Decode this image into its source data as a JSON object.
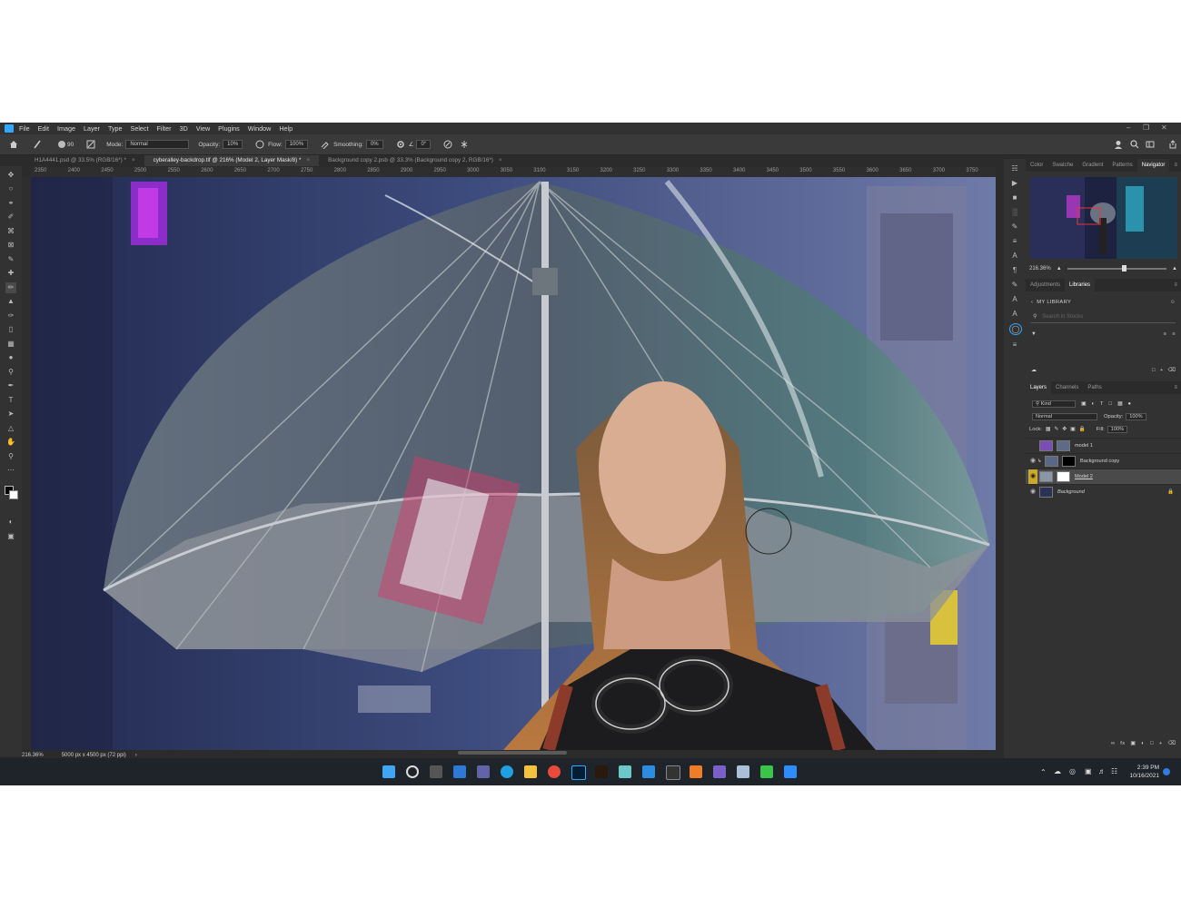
{
  "menubar": {
    "items": [
      "File",
      "Edit",
      "Image",
      "Layer",
      "Type",
      "Select",
      "Filter",
      "3D",
      "View",
      "Plugins",
      "Window",
      "Help"
    ]
  },
  "options": {
    "brush_size": "90",
    "mode_label": "Mode:",
    "mode_value": "Normal",
    "opacity_label": "Opacity:",
    "opacity_value": "10%",
    "flow_label": "Flow:",
    "flow_value": "100%",
    "smoothing_label": "Smoothing:",
    "smoothing_value": "0%",
    "angle_value": "0°"
  },
  "tabs": [
    {
      "label": "H1A4441.psd @ 33.5% (RGB/16*) *"
    },
    {
      "label": "cyberalley-backdrop.tif @ 216% (Model 2, Layer Mask/8) *"
    },
    {
      "label": "Background copy 2.psb @ 33.3% (Background copy 2, RGB/16*)"
    }
  ],
  "ruler": {
    "ticks": [
      "2350",
      "2400",
      "2450",
      "2500",
      "2550",
      "2600",
      "2650",
      "2700",
      "2750",
      "2800",
      "2850",
      "2900",
      "2950",
      "3000",
      "3050",
      "3100",
      "3150",
      "3200",
      "3250",
      "3300",
      "3350",
      "3400",
      "3450",
      "3500",
      "3550",
      "3600",
      "3650",
      "3700",
      "3750"
    ]
  },
  "status": {
    "zoom": "216.36%",
    "doc_size": "5000 px x 4500 px (72 ppi)"
  },
  "panels": {
    "top_tabs": [
      "Color",
      "Swatche",
      "Gradient",
      "Patterns",
      "Navigator"
    ],
    "navigator_zoom": "216.36%",
    "mid_tabs": [
      "Adjustments",
      "Libraries"
    ],
    "library_name": "MY LIBRARY",
    "library_search_placeholder": "Search in Stocks",
    "layer_tabs": [
      "Layers",
      "Channels",
      "Paths"
    ],
    "kind_label": "Kind",
    "blend_mode": "Normal",
    "opacity_label": "Opacity:",
    "opacity_value": "100%",
    "lock_label": "Lock:",
    "fill_label": "Fill:",
    "fill_value": "100%",
    "layers": [
      {
        "name": "model 1",
        "visible": false
      },
      {
        "name": "Background copy",
        "visible": true
      },
      {
        "name": "Model 2",
        "visible": true
      },
      {
        "name": "Background",
        "visible": true
      }
    ]
  },
  "taskbar": {
    "time": "2:39 PM",
    "date": "10/16/2021"
  },
  "colors": {
    "accent": "#31a8ff",
    "layer_highlight": "#c9a92a"
  }
}
